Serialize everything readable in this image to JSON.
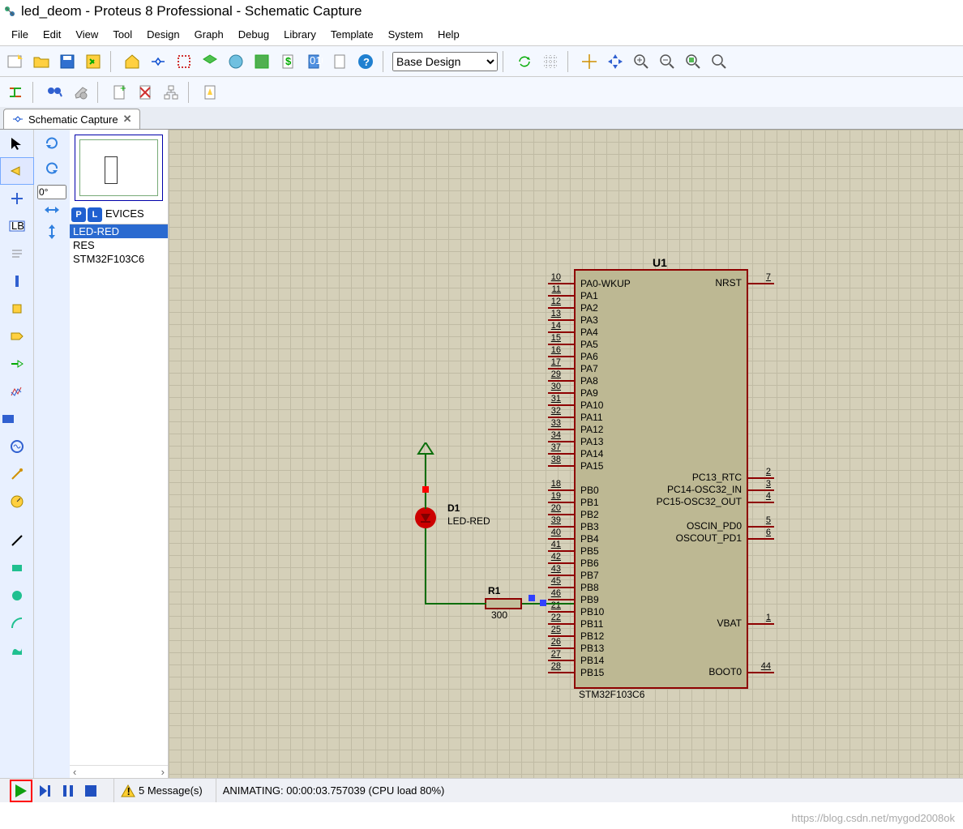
{
  "window_title": "led_deom - Proteus 8 Professional - Schematic Capture",
  "menu": [
    "File",
    "Edit",
    "View",
    "Tool",
    "Design",
    "Graph",
    "Debug",
    "Library",
    "Template",
    "System",
    "Help"
  ],
  "design_select": "Base Design",
  "rotation_value": "0°",
  "tab_title": "Schematic Capture",
  "device_header": "EVICES",
  "devices": [
    "LED-RED",
    "RES",
    "STM32F103C6"
  ],
  "chip": {
    "ref": "U1",
    "part": "STM32F103C6",
    "left_pins": [
      {
        "n": "10",
        "l": "PA0-WKUP"
      },
      {
        "n": "11",
        "l": "PA1"
      },
      {
        "n": "12",
        "l": "PA2"
      },
      {
        "n": "13",
        "l": "PA3"
      },
      {
        "n": "14",
        "l": "PA4"
      },
      {
        "n": "15",
        "l": "PA5"
      },
      {
        "n": "16",
        "l": "PA6"
      },
      {
        "n": "17",
        "l": "PA7"
      },
      {
        "n": "29",
        "l": "PA8"
      },
      {
        "n": "30",
        "l": "PA9"
      },
      {
        "n": "31",
        "l": "PA10"
      },
      {
        "n": "32",
        "l": "PA11"
      },
      {
        "n": "33",
        "l": "PA12"
      },
      {
        "n": "34",
        "l": "PA13"
      },
      {
        "n": "37",
        "l": "PA14"
      },
      {
        "n": "38",
        "l": "PA15"
      },
      {
        "n": "",
        "l": ""
      },
      {
        "n": "18",
        "l": "PB0"
      },
      {
        "n": "19",
        "l": "PB1"
      },
      {
        "n": "20",
        "l": "PB2"
      },
      {
        "n": "39",
        "l": "PB3"
      },
      {
        "n": "40",
        "l": "PB4"
      },
      {
        "n": "41",
        "l": "PB5"
      },
      {
        "n": "42",
        "l": "PB6"
      },
      {
        "n": "43",
        "l": "PB7"
      },
      {
        "n": "45",
        "l": "PB8"
      },
      {
        "n": "46",
        "l": "PB9"
      },
      {
        "n": "21",
        "l": "PB10"
      },
      {
        "n": "22",
        "l": "PB11"
      },
      {
        "n": "25",
        "l": "PB12"
      },
      {
        "n": "26",
        "l": "PB13"
      },
      {
        "n": "27",
        "l": "PB14"
      },
      {
        "n": "28",
        "l": "PB15"
      }
    ],
    "right_pins": [
      {
        "n": "7",
        "l": "NRST",
        "row": 0
      },
      {
        "n": "2",
        "l": "PC13_RTC",
        "row": 16
      },
      {
        "n": "3",
        "l": "PC14-OSC32_IN",
        "row": 17
      },
      {
        "n": "4",
        "l": "PC15-OSC32_OUT",
        "row": 18
      },
      {
        "n": "5",
        "l": "OSCIN_PD0",
        "row": 20
      },
      {
        "n": "6",
        "l": "OSCOUT_PD1",
        "row": 21
      },
      {
        "n": "1",
        "l": "VBAT",
        "row": 28
      },
      {
        "n": "44",
        "l": "BOOT0",
        "row": 32
      }
    ]
  },
  "d1": {
    "ref": "D1",
    "val": "LED-RED"
  },
  "r1": {
    "ref": "R1",
    "val": "300"
  },
  "status": {
    "messages": "5 Message(s)",
    "sim": "ANIMATING: 00:00:03.757039 (CPU load 80%)",
    "watermark": "https://blog.csdn.net/mygod2008ok"
  }
}
